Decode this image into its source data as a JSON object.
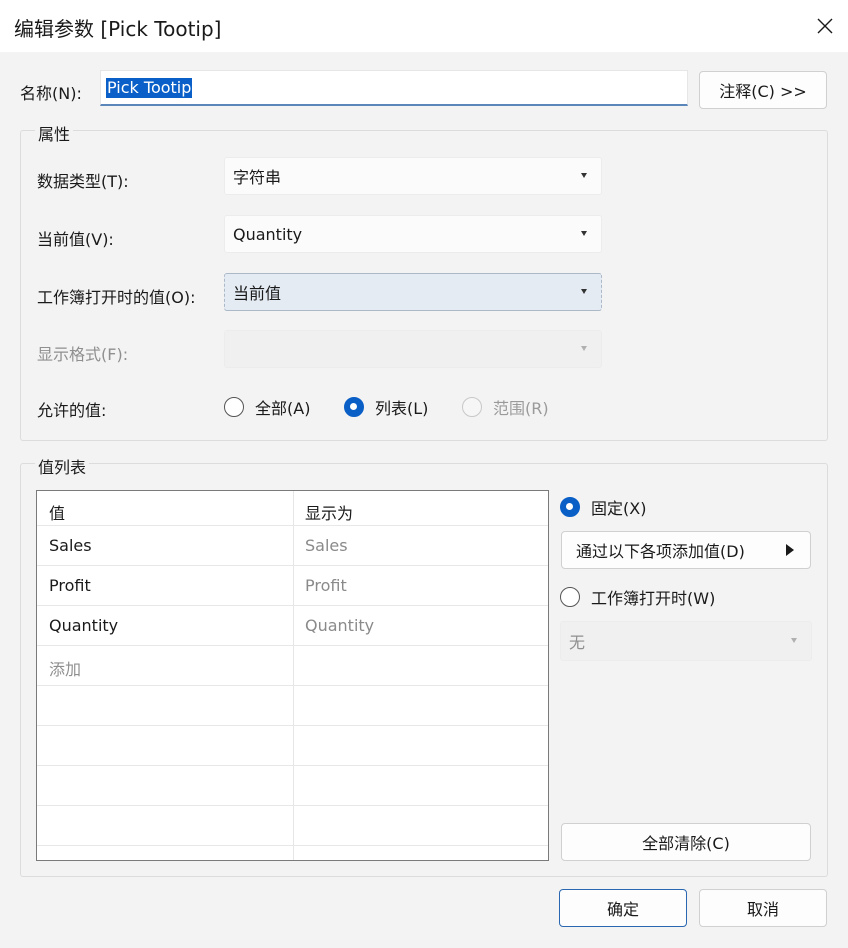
{
  "window": {
    "title": "编辑参数 [Pick Tootip]"
  },
  "name_field": {
    "label": "名称(N):",
    "value": "Pick Tootip"
  },
  "comment_button": "注释(C) >>",
  "properties": {
    "title": "属性",
    "data_type": {
      "label": "数据类型(T):",
      "value": "字符串"
    },
    "current_value": {
      "label": "当前值(V):",
      "value": "Quantity"
    },
    "open_value": {
      "label": "工作簿打开时的值(O):",
      "value": "当前值"
    },
    "display_format": {
      "label": "显示格式(F):",
      "value": ""
    },
    "allowed": {
      "label": "允许的值:",
      "options": [
        "全部(A)",
        "列表(L)",
        "范围(R)"
      ],
      "selected": "列表(L)"
    }
  },
  "value_list": {
    "title": "值列表",
    "columns": [
      "值",
      "显示为"
    ],
    "rows": [
      {
        "value": "Sales",
        "display": "Sales"
      },
      {
        "value": "Profit",
        "display": "Profit"
      },
      {
        "value": "Quantity",
        "display": "Quantity"
      }
    ],
    "add_placeholder": "添加",
    "fixed_label": "固定(X)",
    "add_from_button": "通过以下各项添加值(D)",
    "on_open_label": "工作簿打开时(W)",
    "on_open_value": "无",
    "clear_all_button": "全部清除(C)"
  },
  "footer": {
    "ok": "确定",
    "cancel": "取消"
  },
  "colors": {
    "accent": "#0a5fc7",
    "selection": "#0a60c8",
    "background": "#f3f3f3"
  }
}
